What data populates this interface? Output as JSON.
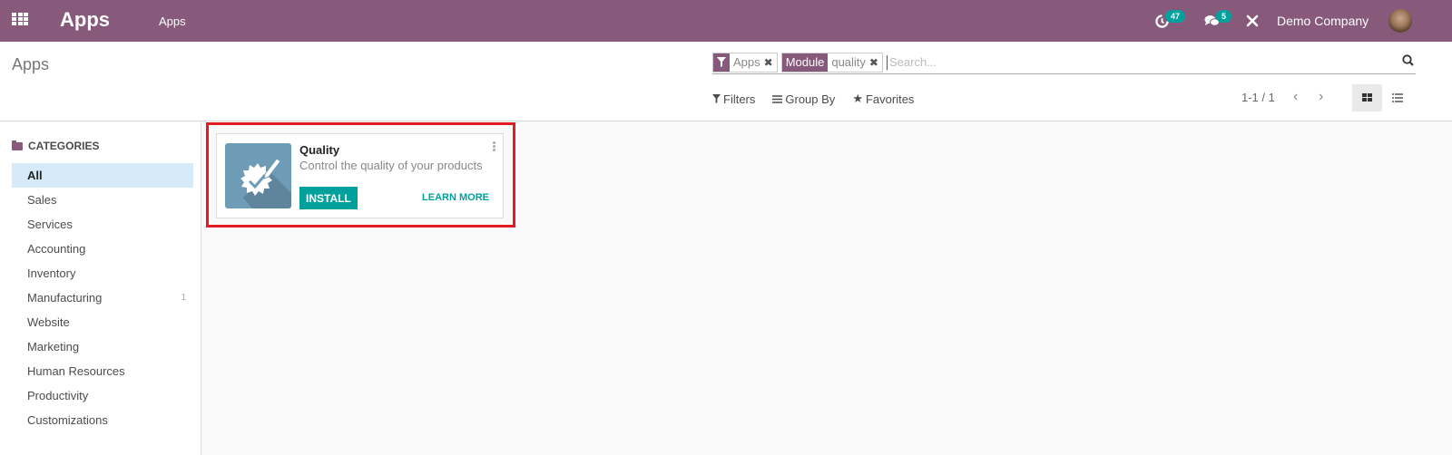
{
  "navbar": {
    "brand": "Apps",
    "menu_item": "Apps",
    "activity_count": "47",
    "message_count": "5",
    "company": "Demo Company"
  },
  "control_panel": {
    "breadcrumb": "Apps",
    "facets": [
      {
        "type": "filter",
        "value": "Apps"
      },
      {
        "type": "field",
        "label": "Module",
        "value": "quality"
      }
    ],
    "search_placeholder": "Search...",
    "filters_label": "Filters",
    "group_by_label": "Group By",
    "favorites_label": "Favorites",
    "pager": "1-1 / 1",
    "active_view": "kanban"
  },
  "sidebar": {
    "header": "CATEGORIES",
    "items": [
      {
        "label": "All",
        "active": true,
        "count": ""
      },
      {
        "label": "Sales",
        "count": ""
      },
      {
        "label": "Services",
        "count": ""
      },
      {
        "label": "Accounting",
        "count": ""
      },
      {
        "label": "Inventory",
        "count": ""
      },
      {
        "label": "Manufacturing",
        "count": "1"
      },
      {
        "label": "Website",
        "count": ""
      },
      {
        "label": "Marketing",
        "count": ""
      },
      {
        "label": "Human Resources",
        "count": ""
      },
      {
        "label": "Productivity",
        "count": ""
      },
      {
        "label": "Customizations",
        "count": ""
      }
    ]
  },
  "apps": [
    {
      "name": "Quality",
      "summary": "Control the quality of your products",
      "install_label": "INSTALL",
      "learn_more_label": "LEARN MORE",
      "icon": "quality-badge-pencil-icon"
    }
  ],
  "colors": {
    "brand": "#875a7b",
    "accent": "#00a09d",
    "highlight": "#e31b23",
    "active_category": "#d6ebfa"
  }
}
